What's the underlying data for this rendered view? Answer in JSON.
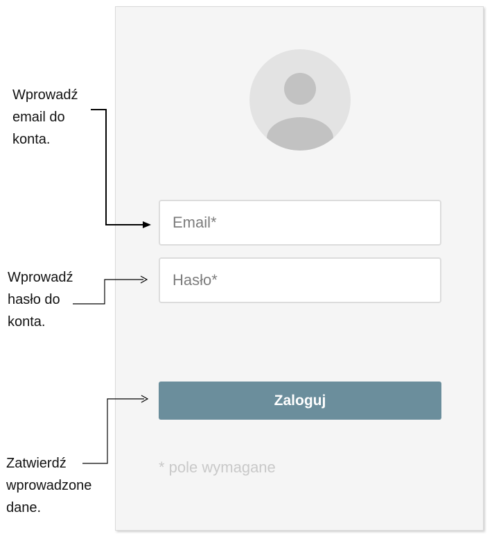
{
  "login": {
    "email_placeholder": "Email*",
    "password_placeholder": "Hasło*",
    "submit_label": "Zaloguj",
    "required_note": "* pole wymagane"
  },
  "annotations": {
    "email": [
      "Wprowadź",
      "email do",
      "konta."
    ],
    "password": [
      "Wprowadź",
      "hasło do",
      "konta."
    ],
    "submit": [
      "Zatwierdź",
      "wprowadzone",
      "dane."
    ]
  },
  "colors": {
    "panel_background": "#f5f5f5",
    "button_background": "#6b8e9c",
    "avatar_background": "#e3e3e3",
    "avatar_figure": "#c2c2c2"
  },
  "icons": {
    "avatar": "user-avatar-icon",
    "arrows": "arrow-right-icon"
  }
}
